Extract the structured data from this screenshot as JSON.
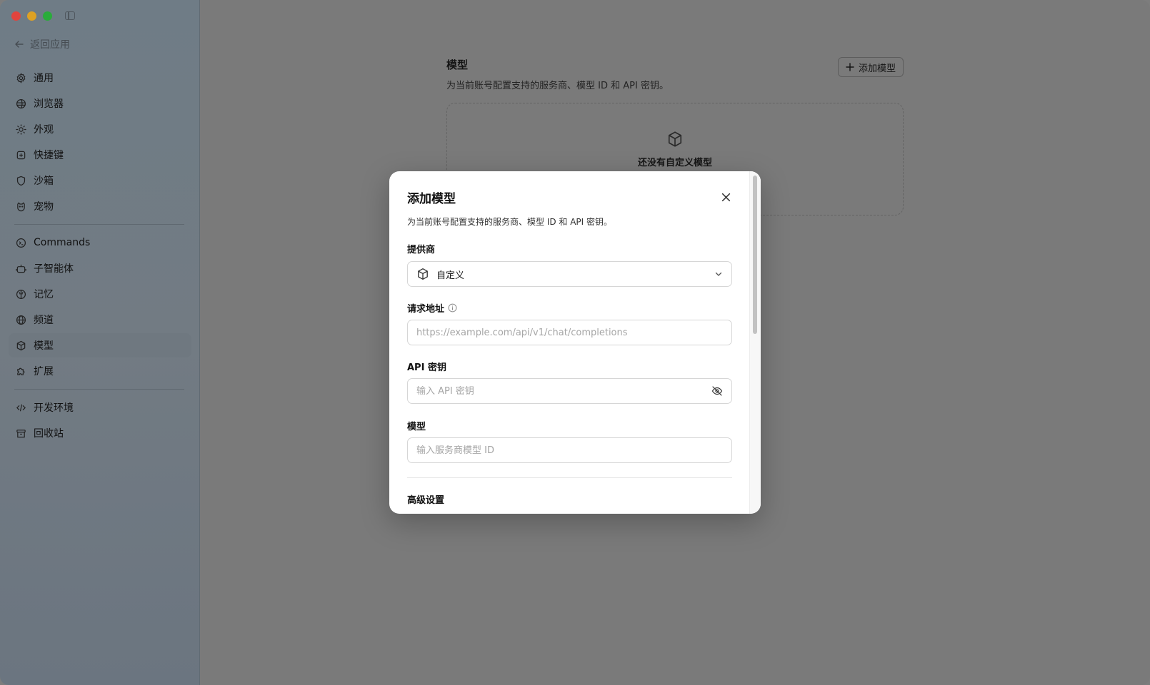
{
  "sidebar": {
    "back_label": "返回应用",
    "group1": [
      {
        "label": "通用",
        "icon": "gear-icon"
      },
      {
        "label": "浏览器",
        "icon": "browser-icon"
      },
      {
        "label": "外观",
        "icon": "sun-icon"
      },
      {
        "label": "快捷键",
        "icon": "keyboard-icon"
      },
      {
        "label": "沙箱",
        "icon": "shield-icon"
      },
      {
        "label": "宠物",
        "icon": "pet-icon"
      }
    ],
    "group2": [
      {
        "label": "Commands",
        "icon": "command-icon"
      },
      {
        "label": "子智能体",
        "icon": "robot-icon"
      },
      {
        "label": "记忆",
        "icon": "brain-icon"
      },
      {
        "label": "频道",
        "icon": "globe-icon"
      },
      {
        "label": "模型",
        "icon": "cube-icon"
      },
      {
        "label": "扩展",
        "icon": "puzzle-icon"
      }
    ],
    "group3": [
      {
        "label": "开发环境",
        "icon": "code-icon"
      },
      {
        "label": "回收站",
        "icon": "trash-icon"
      }
    ],
    "active": "模型"
  },
  "main": {
    "title": "模型",
    "subtitle": "为当前账号配置支持的服务商、模型 ID 和 API 密钥。",
    "add_button": "添加模型",
    "empty_title": "还没有自定义模型"
  },
  "modal": {
    "title": "添加模型",
    "subtitle": "为当前账号配置支持的服务商、模型 ID 和 API 密钥。",
    "provider_label": "提供商",
    "provider_value": "自定义",
    "url_label": "请求地址",
    "url_placeholder": "https://example.com/api/v1/chat/completions",
    "apikey_label": "API 密钥",
    "apikey_placeholder": "输入 API 密钥",
    "model_label": "模型",
    "model_placeholder": "输入服务商模型 ID",
    "advanced_label": "高级设置"
  }
}
